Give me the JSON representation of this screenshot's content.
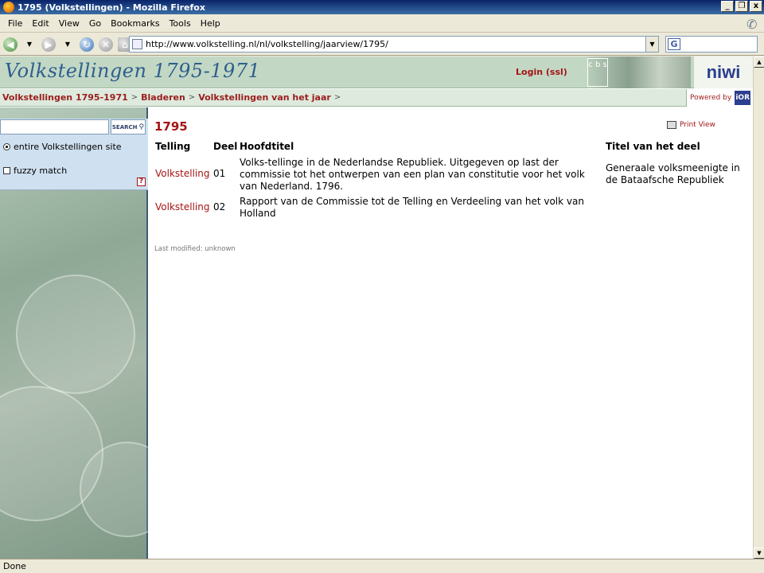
{
  "window": {
    "title": "1795 (Volkstellingen) - Mozilla Firefox",
    "controls": [
      "_",
      "❐",
      "x"
    ]
  },
  "menu": [
    "File",
    "Edit",
    "View",
    "Go",
    "Bookmarks",
    "Tools",
    "Help"
  ],
  "nav": {
    "url": "http://www.volkstelling.nl/nl/volkstelling/jaarview/1795/",
    "search_engine_letter": "G"
  },
  "site": {
    "logo": "Volkstellingen 1795-1971",
    "login": "Login (ssl)",
    "cbs_text": "c b s",
    "niwi": "niwi",
    "breadcrumbs": [
      "Volkstellingen 1795-1971",
      "Bladeren",
      "Volkstellingen van het jaar"
    ],
    "crumb_separator": ">",
    "powered_by": "Powered by",
    "powered_logo": "iOR"
  },
  "sidebar": {
    "search_button": "SEARCH",
    "option_site": "entire Volkstellingen site",
    "option_fuzzy": "fuzzy match",
    "help": "?"
  },
  "main": {
    "title": "1795",
    "print_view": "Print View",
    "headers": {
      "telling": "Telling",
      "deel": "Deel",
      "hoofdtitel": "Hoofdtitel",
      "titel_deel": "Titel van het deel"
    },
    "rows": [
      {
        "telling": "Volkstelling",
        "deel": "01",
        "hoofdtitel": "Volks-tellinge in de Nederlandse Republiek. Uitgegeven op last der commissie tot het ontwerpen van een plan van constitutie voor het volk van Nederland. 1796.",
        "titel_deel": "Generaale volksmeenigte in de Bataafsche Republiek"
      },
      {
        "telling": "Volkstelling",
        "deel": "02",
        "hoofdtitel": "Rapport van de Commissie tot de Telling en Verdeeling van het volk van Holland",
        "titel_deel": ""
      }
    ],
    "last_modified": "Last modified: unknown"
  },
  "status": "Done",
  "colors": {
    "accent": "#a31515",
    "header_green": "#c2d8c4",
    "logo_blue": "#2f5e8d"
  }
}
